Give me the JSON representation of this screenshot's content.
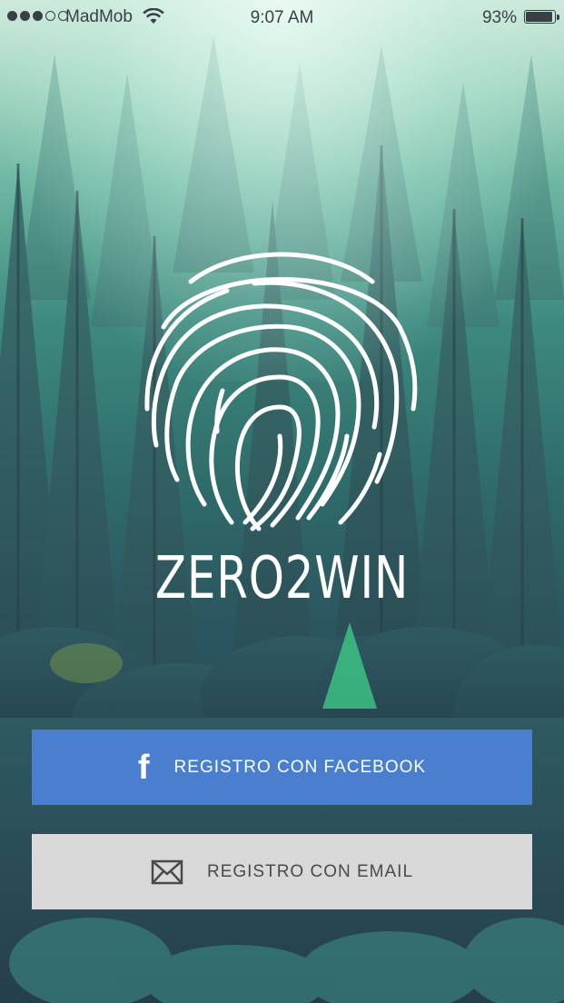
{
  "status_bar": {
    "carrier": "MadMob",
    "time": "9:07 AM",
    "battery_percent": "93%",
    "battery_level": 0.93,
    "signal_bars_filled": 3,
    "signal_bars_total": 5
  },
  "brand": {
    "name": "ZERO2WIN",
    "logo_icon": "fingerprint-icon"
  },
  "buttons": {
    "facebook": {
      "label": "REGISTRO CON FACEBOOK",
      "icon": "facebook-icon",
      "icon_glyph": "f",
      "color": "#4a7fcf"
    },
    "email": {
      "label": "REGISTRO CON EMAIL",
      "icon": "envelope-icon",
      "color": "#d9d9d9"
    }
  }
}
